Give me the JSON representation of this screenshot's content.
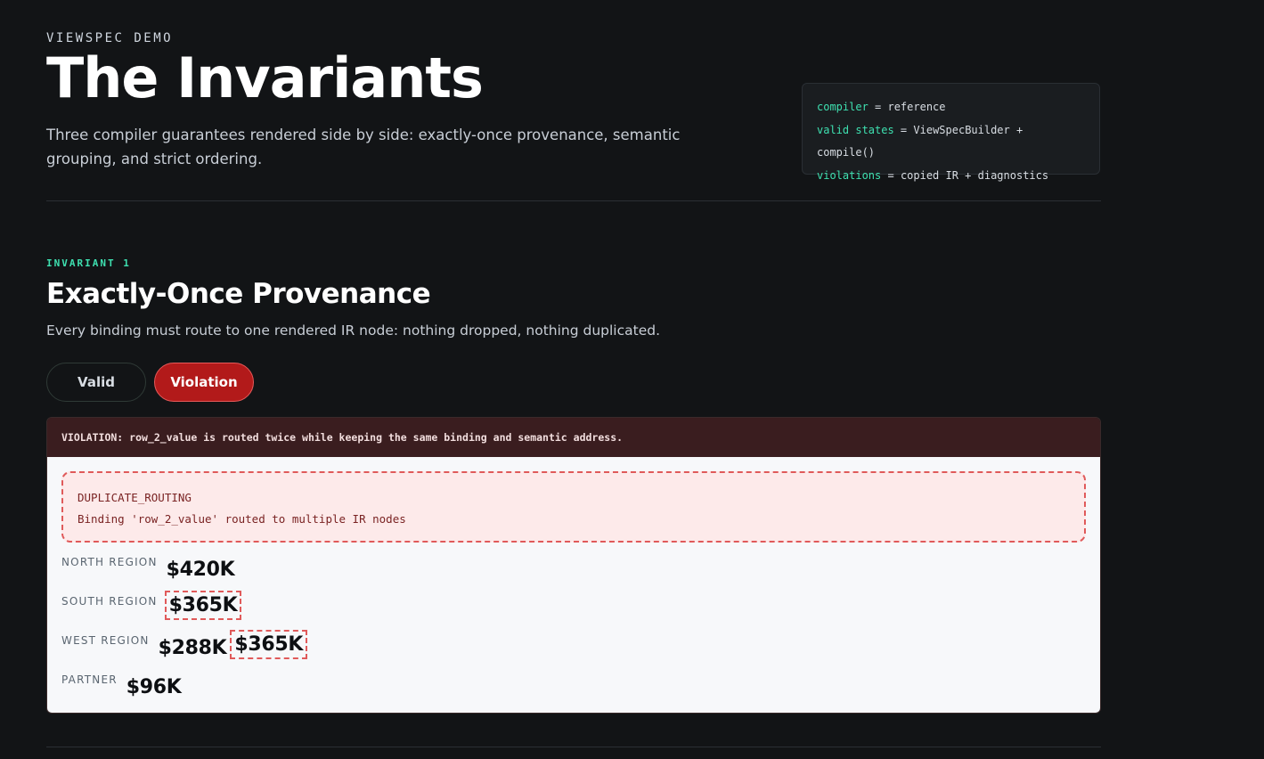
{
  "header": {
    "eyebrow": "VIEWSPEC DEMO",
    "title": "The Invariants",
    "intro": "Three compiler guarantees rendered side by side: exactly-once provenance, semantic grouping, and strict ordering."
  },
  "code_card": {
    "lines": [
      {
        "key": "compiler",
        "op": " = ",
        "value": "reference"
      },
      {
        "key": "valid states",
        "op": " = ",
        "value": "ViewSpecBuilder + compile()"
      },
      {
        "key": "violations",
        "op": " = ",
        "value": "copied IR + diagnostics"
      }
    ]
  },
  "section": {
    "eyebrow": "INVARIANT 1",
    "title": "Exactly-Once Provenance",
    "description": "Every binding must route to one rendered IR node: nothing dropped, nothing duplicated.",
    "toggle": {
      "valid_label": "Valid",
      "violation_label": "Violation",
      "selected": "Violation"
    },
    "banner": "VIOLATION: row_2_value is routed twice while keeping the same binding and semantic address.",
    "diagnostic": {
      "code": "DUPLICATE_ROUTING",
      "message": "Binding 'row_2_value' routed to multiple IR nodes"
    },
    "rows": [
      {
        "label": "NORTH REGION",
        "value": "$420K"
      },
      {
        "label": "SOUTH REGION",
        "value": "$365K"
      },
      {
        "label": "WEST REGION",
        "value": "$288K",
        "duplicate": "$365K"
      },
      {
        "label": "PARTNER",
        "value": "$96K"
      }
    ]
  },
  "colors": {
    "accent": "#3ee0b0",
    "violation": "#b21a1a",
    "diagnostic_border": "#e05a5a"
  }
}
